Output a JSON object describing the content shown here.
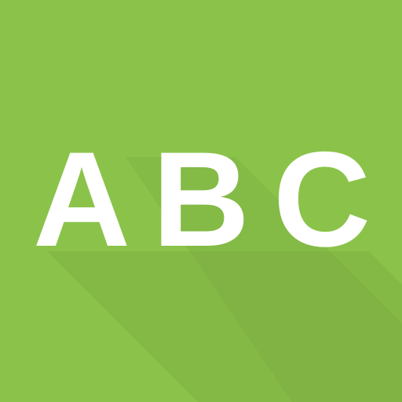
{
  "icon": {
    "background_color": "#8bc34a",
    "shadow_color": "#6f9f3a",
    "letter_color": "#ffffff",
    "letters": [
      "A",
      "B",
      "C"
    ]
  }
}
